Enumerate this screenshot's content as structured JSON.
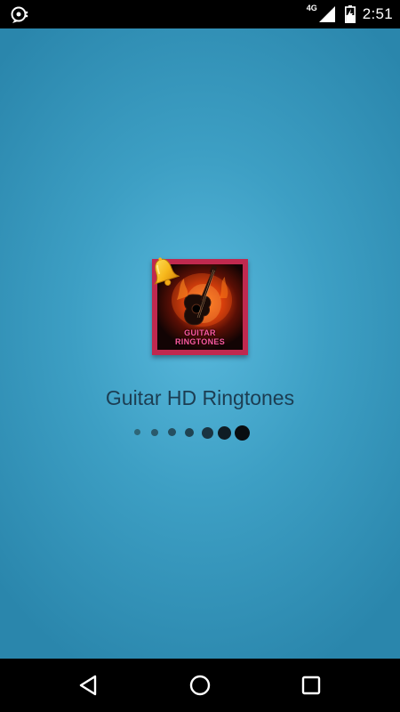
{
  "status_bar": {
    "network_type": "4G",
    "time": "2:51",
    "left_icon": "app-notification-icon",
    "signal_icon": "signal-icon",
    "battery_icon": "battery-charging-icon"
  },
  "splash": {
    "app_icon_text_line1": "GUITAR",
    "app_icon_text_line2": "RINGTONES",
    "app_title": "Guitar HD Ringtones",
    "loader_active_dot_count": 7,
    "colors": {
      "background_center": "#58b8dc",
      "background_edge": "#2a86ac",
      "icon_border": "#c0294f",
      "title_text": "#1c3d52"
    }
  },
  "nav_bar": {
    "back_icon": "back-icon",
    "home_icon": "home-icon",
    "recents_icon": "recents-icon"
  }
}
